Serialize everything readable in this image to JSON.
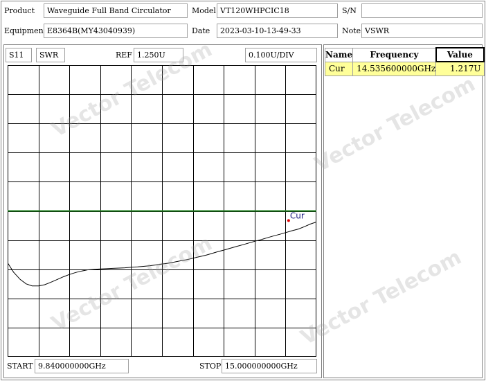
{
  "header": {
    "product_label": "Product",
    "product_value": "Waveguide Full Band Circulator",
    "model_label": "Model",
    "model_value": "VT120WHPCIC18",
    "sn_label": "S/N",
    "sn_value": "",
    "equipment_label": "Equipment",
    "equipment_value": "E8364B(MY43040939)",
    "date_label": "Date",
    "date_value": "2023-03-10-13-49-33",
    "note_label": "Note",
    "note_value": "VSWR"
  },
  "chart_header": {
    "param": "S11",
    "format": "SWR",
    "ref_label": "REF",
    "ref_value": "1.250U",
    "scale_value": "0.100U/DIV"
  },
  "footer": {
    "start_label": "START",
    "start_value": "9.840000000GHz",
    "stop_label": "STOP",
    "stop_value": "15.000000000GHz"
  },
  "marker_table": {
    "headers": [
      "Name",
      "Frequency",
      "Value"
    ],
    "rows": [
      {
        "name": "Cur",
        "frequency": "14.535600000GHz",
        "value": "1.217U"
      }
    ]
  },
  "watermark_text": "Vector Telecom",
  "chart_data": {
    "type": "line",
    "x_unit": "GHz",
    "y_unit": "U",
    "xlim": [
      9.84,
      15.0
    ],
    "ylim": [
      0.75,
      1.75
    ],
    "ref_level": 1.25,
    "divisions_x": 10,
    "divisions_y": 10,
    "grid": true,
    "series": [
      {
        "color": "#000000",
        "x": [
          9.84,
          9.94,
          10.05,
          10.15,
          10.25,
          10.36,
          10.46,
          10.56,
          10.67,
          10.77,
          10.87,
          10.98,
          11.08,
          11.18,
          11.29,
          11.39,
          11.49,
          11.6,
          11.7,
          11.8,
          11.91,
          12.01,
          12.11,
          12.22,
          12.32,
          12.42,
          12.53,
          12.63,
          12.73,
          12.84,
          12.94,
          13.04,
          13.15,
          13.25,
          13.35,
          13.46,
          13.56,
          13.66,
          13.77,
          13.87,
          13.97,
          14.08,
          14.18,
          14.28,
          14.39,
          14.49,
          14.59,
          14.7,
          14.8,
          14.9,
          15.0
        ],
        "y": [
          1.072,
          1.04,
          1.015,
          1.0,
          0.993,
          0.993,
          0.997,
          1.005,
          1.015,
          1.024,
          1.032,
          1.039,
          1.044,
          1.048,
          1.05,
          1.051,
          1.052,
          1.053,
          1.054,
          1.055,
          1.057,
          1.058,
          1.06,
          1.062,
          1.065,
          1.068,
          1.071,
          1.075,
          1.079,
          1.083,
          1.088,
          1.093,
          1.098,
          1.104,
          1.11,
          1.116,
          1.122,
          1.128,
          1.134,
          1.14,
          1.146,
          1.152,
          1.158,
          1.164,
          1.17,
          1.176,
          1.182,
          1.188,
          1.196,
          1.205,
          1.212
        ]
      }
    ],
    "ref_line": {
      "color": "#208020",
      "value": 1.25
    },
    "markers": [
      {
        "name": "Cur",
        "x": 14.5356,
        "y": 1.217,
        "color": "#e00000"
      }
    ]
  }
}
